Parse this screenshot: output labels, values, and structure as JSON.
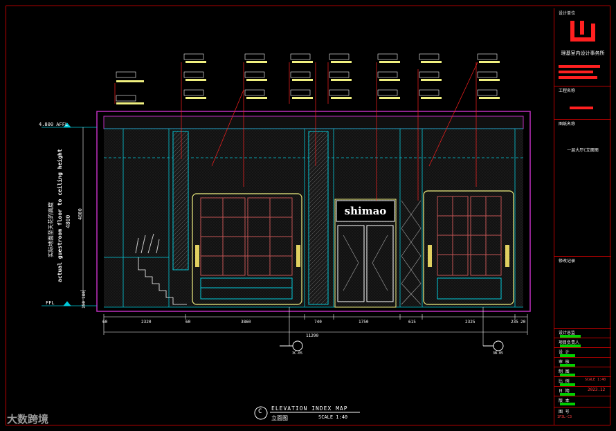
{
  "drawing": {
    "title_en": "ELEVATION INDEX MAP",
    "title_cn": "立面图",
    "scale": "SCALE 1:40",
    "index_letter": "C",
    "shop_sign": "shimao",
    "level_top": "4.800 AFFL",
    "level_floor": "FFL",
    "height_cn": "实际地面至天花的高度",
    "height_en": "actual guestroom floor to ceiling height",
    "height_value": "4800",
    "height_inner": "4800",
    "dim_small_1": "150",
    "dim_small_2": "180",
    "dims": [
      "60",
      "2320",
      "60",
      "3860",
      "740",
      "1750",
      "615",
      "2325",
      "235",
      "20"
    ],
    "dim_total": "11290",
    "section_tags": [
      "3C-05",
      "3B-05"
    ]
  },
  "title_block": {
    "firm_label": "设计单位",
    "firm_name": "理基室内设计事务所",
    "project_label": "工程名称",
    "drawing_label": "图纸名称",
    "drawing_name": "一层大厅C立面图",
    "notes_label": "修改记录",
    "rows": [
      {
        "label": "设计总监"
      },
      {
        "label": "项目负责人"
      },
      {
        "label": "设 计"
      },
      {
        "label": "审 核"
      },
      {
        "label": "制 图"
      },
      {
        "label": "比 例",
        "value": "SCALE 1:40"
      },
      {
        "label": "日 期",
        "value": "2023.12"
      },
      {
        "label": "版 本"
      },
      {
        "label": "图 号",
        "value": "1F3L-C3"
      }
    ]
  },
  "watermark": "大数跨境",
  "colors": {
    "frame": "#c00000",
    "cyan": "#00c8d8",
    "magenta": "#c030c0",
    "yellow": "#f0f080",
    "red": "#ff2020",
    "green": "#00d000"
  }
}
